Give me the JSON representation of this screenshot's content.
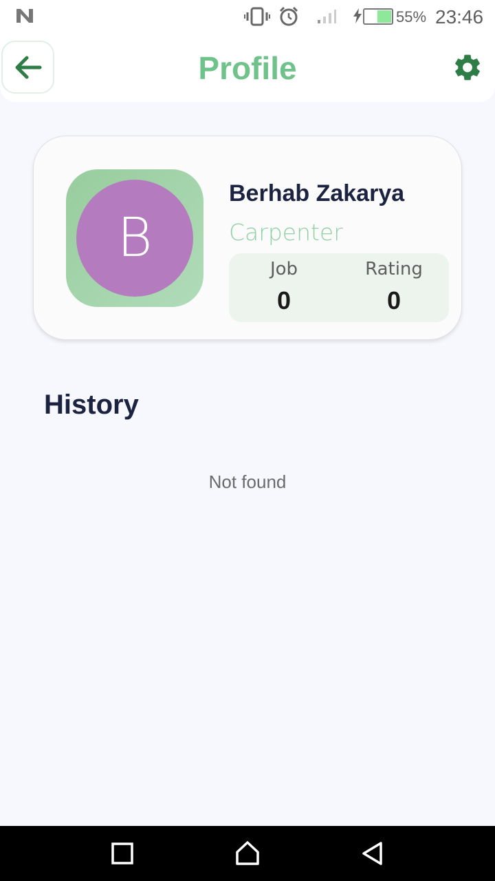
{
  "status_bar": {
    "battery_percent": "55%",
    "time": "23:46",
    "icons": [
      "n-logo-icon",
      "vibrate-icon",
      "alarm-icon",
      "signal-icon",
      "charging-icon",
      "battery-icon"
    ],
    "battery_level": 0.55,
    "battery_color": "#8ee89a"
  },
  "app_bar": {
    "title": "Profile",
    "back_icon": "arrow-left-icon",
    "settings_icon": "gear-icon",
    "accent_color": "#6fc28a",
    "icon_color": "#2e7d46"
  },
  "profile": {
    "avatar_initial": "B",
    "avatar_color": "#b47cbf",
    "name": "Berhab Zakarya",
    "profession": "Carpenter",
    "stats": [
      {
        "label": "Job",
        "value": "0"
      },
      {
        "label": "Rating",
        "value": "0"
      }
    ]
  },
  "history": {
    "title": "History",
    "empty_text": "Not found"
  },
  "nav_bar": {
    "icons": [
      "recents-icon",
      "home-icon",
      "back-nav-icon"
    ]
  }
}
